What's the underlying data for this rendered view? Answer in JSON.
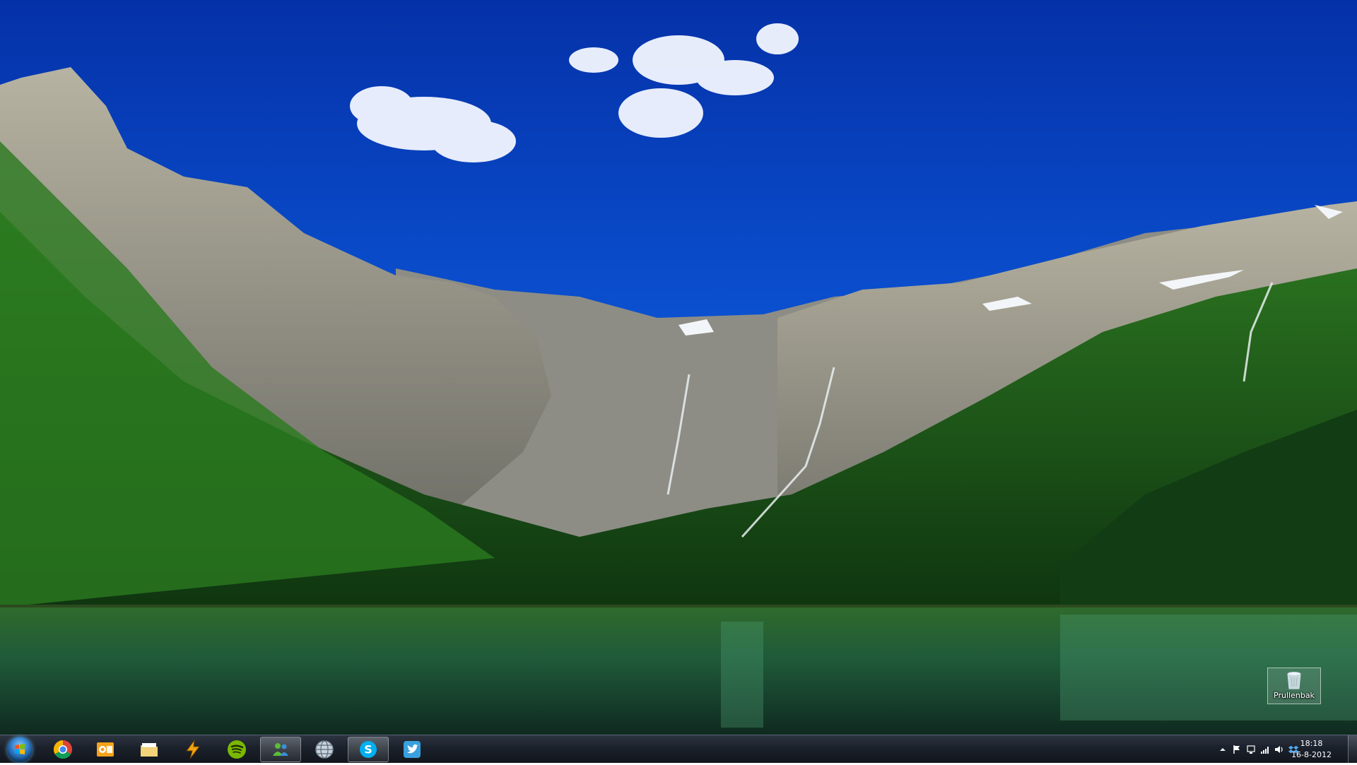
{
  "desktop": {
    "icons": [
      {
        "label": "Prullenbak",
        "icon": "recycle-bin-icon"
      }
    ]
  },
  "taskbar": {
    "start_icon": "windows-start-orb-icon",
    "pinned": [
      {
        "icon": "chrome-icon"
      },
      {
        "icon": "outlook-icon"
      },
      {
        "icon": "file-explorer-icon"
      },
      {
        "icon": "winamp-icon"
      },
      {
        "icon": "spotify-icon"
      },
      {
        "icon": "messenger-icon",
        "active": true
      },
      {
        "icon": "web-browser-globe-icon"
      },
      {
        "icon": "skype-icon",
        "active": true
      },
      {
        "icon": "twitter-icon"
      }
    ],
    "tray": {
      "icons": [
        "show-hidden-icons-arrow",
        "action-center-flag-icon",
        "network-icon",
        "signal-icon",
        "volume-icon",
        "dropbox-icon"
      ],
      "time": "18:18",
      "date": "16-8-2012"
    }
  }
}
